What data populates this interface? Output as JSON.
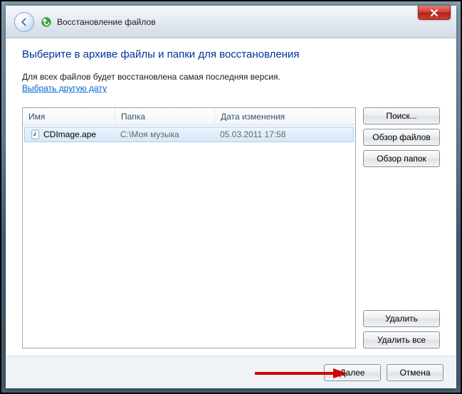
{
  "window": {
    "title": "Восстановление файлов"
  },
  "page": {
    "heading": "Выберите в архиве файлы и папки для восстановления",
    "subtext": "Для всех файлов будет восстановлена самая последняя версия.",
    "choose_date": "Выбрать другую дату"
  },
  "columns": {
    "name": "Имя",
    "folder": "Папка",
    "date": "Дата изменения"
  },
  "rows": [
    {
      "name": "CDImage.ape",
      "folder": "C:\\Моя музыка",
      "date": "05.03.2011 17:58"
    }
  ],
  "buttons": {
    "search": "Поиск...",
    "browse_files": "Обзор файлов",
    "browse_folders": "Обзор папок",
    "remove": "Удалить",
    "remove_all": "Удалить все",
    "next": "Далее",
    "cancel": "Отмена"
  }
}
